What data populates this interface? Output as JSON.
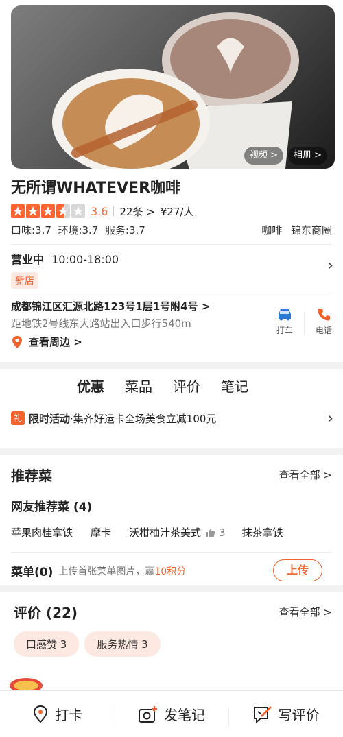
{
  "hero": {
    "video_label": "视频 >",
    "album_label": "相册 >"
  },
  "shop": {
    "name": "无所谓WHATEVER咖啡",
    "rating": "3.6",
    "rating_value": 3.6,
    "reviews_count": "22条 >",
    "price": "¥27/人",
    "scores": "口味:3.7  环境:3.7  服务:3.7",
    "category": "咖啡",
    "area": "锦东商圈"
  },
  "hours": {
    "status": "营业中",
    "time": "10:00-18:00",
    "badge": "新店"
  },
  "address": {
    "main": "成都锦江区汇源北路123号1层1号附4号 >",
    "distance": "距地铁2号线东大路站出入口步行540m",
    "nearby": "查看周边 >",
    "taxi_label": "打车",
    "phone_label": "电话"
  },
  "tabs": [
    "优惠",
    "菜品",
    "评价",
    "笔记"
  ],
  "promo": {
    "icon": "礼",
    "title": "限时活动",
    "text": "·集齐好运卡全场美食立减100元"
  },
  "recommend": {
    "title": "推荐菜",
    "all": "查看全部 >",
    "subtitle": "网友推荐菜 (4)",
    "dishes": [
      "苹果肉桂拿铁",
      "摩卡",
      "沃柑柚汁茶美式",
      "抹茶拿铁"
    ],
    "like_count": "3",
    "menu_title": "菜单(0)",
    "menu_hint": "上传首张菜单图片，赢",
    "menu_points": "10积分",
    "upload": "上传"
  },
  "reviews": {
    "title": "评价 (22)",
    "all": "查看全部 >",
    "chips": [
      "口感赞 3",
      "服务热情 3"
    ]
  },
  "bottom_bar": {
    "checkin": "打卡",
    "note": "发笔记",
    "review": "写评价"
  },
  "colors": {
    "accent": "#ff6633",
    "accent_light": "#fde9e2"
  }
}
